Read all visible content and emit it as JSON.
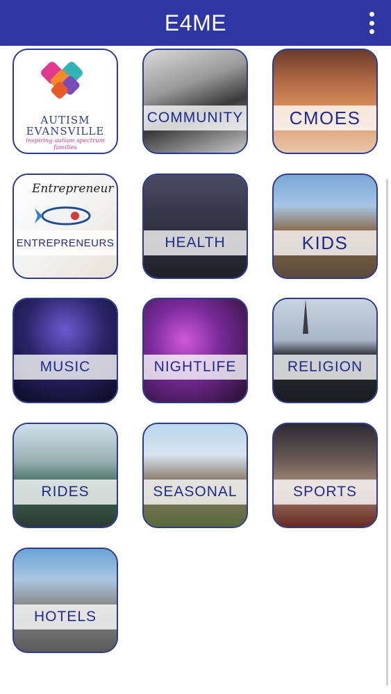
{
  "appbar": {
    "title": "E4ME",
    "overflow_icon": "more-vertical-icon",
    "color": "#2d36a2"
  },
  "tiles": [
    {
      "id": "autism-evansville",
      "label": "",
      "logo_line1": "AUTISM",
      "logo_line2": "EVANSVILLE",
      "logo_tagline": "inspiring autism spectrum families"
    },
    {
      "id": "community",
      "label": "COMMUNITY"
    },
    {
      "id": "cmoes",
      "label": "CMOES"
    },
    {
      "id": "entrepreneurs",
      "label": "ENTREPRENEURS",
      "art_text": "Entrepreneur"
    },
    {
      "id": "health",
      "label": "HEALTH"
    },
    {
      "id": "kids",
      "label": "KIDS"
    },
    {
      "id": "music",
      "label": "MUSIC"
    },
    {
      "id": "nightlife",
      "label": "NIGHTLIFE"
    },
    {
      "id": "religion",
      "label": "RELIGION"
    },
    {
      "id": "rides",
      "label": "RIDES"
    },
    {
      "id": "seasonal",
      "label": "SEASONAL"
    },
    {
      "id": "sports",
      "label": "SPORTS"
    },
    {
      "id": "hotels",
      "label": "HOTELS"
    }
  ]
}
